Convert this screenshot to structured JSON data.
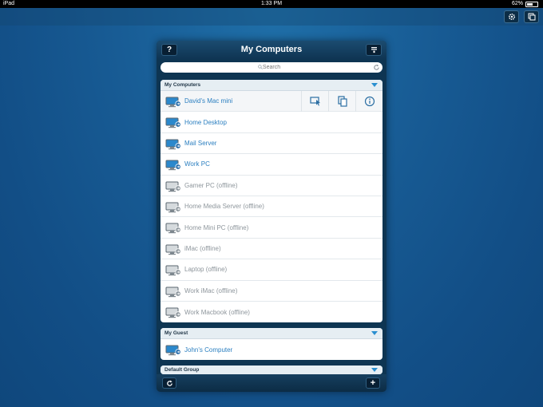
{
  "status_bar": {
    "device": "iPad",
    "wifi_icon": "wifi-icon",
    "time": "1:33 PM",
    "battery": "62%"
  },
  "top_bar": {
    "settings_icon": "gear-icon",
    "window_icon": "copy-windows-icon"
  },
  "panel": {
    "title": "My Computers",
    "help_label": "?",
    "search": {
      "placeholder": "Search"
    },
    "groups": [
      {
        "name": "My Computers",
        "computers": [
          {
            "label": "David's Mac mini",
            "status": "online"
          },
          {
            "label": "Home Desktop",
            "status": "online"
          },
          {
            "label": "Mail Server",
            "status": "online"
          },
          {
            "label": "Work PC",
            "status": "online"
          },
          {
            "label": "Gamer PC (offline)",
            "status": "offline"
          },
          {
            "label": "Home Media Server (offline)",
            "status": "offline"
          },
          {
            "label": "Home Mini PC (offline)",
            "status": "offline"
          },
          {
            "label": "iMac (offline)",
            "status": "offline"
          },
          {
            "label": "Laptop (offline)",
            "status": "offline"
          },
          {
            "label": "Work iMac (offline)",
            "status": "offline"
          },
          {
            "label": "Work Macbook (offline)",
            "status": "offline"
          }
        ]
      },
      {
        "name": "My Guest",
        "computers": [
          {
            "label": "John's Computer",
            "status": "online"
          }
        ]
      },
      {
        "name": "Default Group",
        "computers": []
      }
    ],
    "footer": {
      "refresh_icon": "refresh-icon",
      "add_label": "+"
    }
  },
  "colors": {
    "accent": "#2b7fc0",
    "offline_text": "#8e969c",
    "panel_bg": "#0e3552"
  }
}
